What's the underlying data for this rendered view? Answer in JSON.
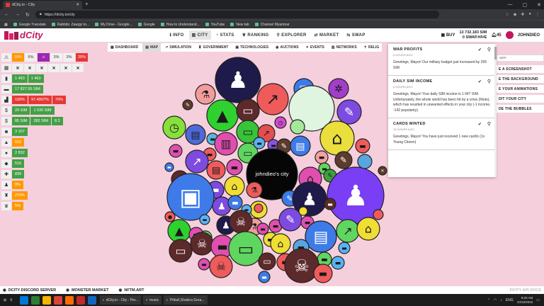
{
  "browser": {
    "tab_title": "dCity.io - City",
    "url": "https://dcity.io/city",
    "bookmarks": [
      "Google Translate",
      "Rabbits: Zawgyi to...",
      "My Drive - Google...",
      "Google",
      "How to Understand...",
      "YouTube",
      "New tab",
      "Channel Myanmar"
    ]
  },
  "header": {
    "logo_text": "dCity",
    "nav": [
      {
        "label": "INFO",
        "icon": "info-icon"
      },
      {
        "label": "CITY",
        "icon": "city-icon",
        "active": true
      },
      {
        "label": "STATS",
        "icon": "stats-icon"
      },
      {
        "label": "RANKING",
        "icon": "trophy-icon"
      },
      {
        "label": "EXPLORER",
        "icon": "search-icon"
      },
      {
        "label": "MARKET",
        "icon": "market-icon"
      },
      {
        "label": "SWAP",
        "icon": "swap-icon"
      }
    ],
    "buy_label": "BUY",
    "balance_sim": "13 732.183 SIM",
    "balance_swap": "0 SWAP.HIVE",
    "notif_count": "45",
    "username": "JOHNDIEO"
  },
  "subnav": [
    {
      "label": "DASHBOARD",
      "icon": "dashboard-icon"
    },
    {
      "label": "MAP",
      "icon": "map-icon",
      "active": true
    },
    {
      "label": "SIMULATION",
      "icon": "simulation-icon"
    },
    {
      "label": "GOVERNMENT",
      "icon": "government-icon"
    },
    {
      "label": "TECHNOLOGIES",
      "icon": "technologies-icon"
    },
    {
      "label": "AUCTIONS",
      "icon": "auctions-icon"
    },
    {
      "label": "EVENTS",
      "icon": "events-icon"
    },
    {
      "label": "NETWORKS",
      "icon": "networks-icon"
    },
    {
      "label": "RELIG",
      "icon": "religion-icon"
    }
  ],
  "sidebar": {
    "rows": [
      {
        "icon": "warning-icon",
        "glyph": "⚠",
        "chips": [
          {
            "text": "10%",
            "color": "#ff9800"
          },
          {
            "text": "6%",
            "color": "#f0f0f0",
            "dark": true
          },
          {
            "text": "☺",
            "color": "#9c27b0"
          },
          {
            "text": "3%",
            "color": "#f0f0f0",
            "dark": true
          },
          {
            "text": "3%",
            "color": "#f0f0f0",
            "dark": true
          },
          {
            "text": "20%",
            "color": "#e53935"
          }
        ]
      },
      {
        "icon": "calendar-icon",
        "glyph": "▦",
        "xs": 6
      },
      {
        "icon": "building-icon",
        "glyph": "▮",
        "chips": [
          {
            "text": "1 463",
            "color": "#43a047"
          },
          {
            "text": "1 463",
            "color": "#43a047"
          }
        ]
      },
      {
        "icon": "money-icon",
        "glyph": "▬",
        "chips": [
          {
            "text": "17 827.55 SIM",
            "color": "#43a047"
          }
        ]
      },
      {
        "icon": "pollution-icon",
        "glyph": "▟",
        "chips": [
          {
            "text": "100%",
            "color": "#e53935"
          },
          {
            "text": "97.4907%",
            "color": "#e53935"
          },
          {
            "text": "70%",
            "color": "#e53935"
          }
        ]
      },
      {
        "icon": "income-icon",
        "glyph": "$",
        "chips": [
          {
            "text": "29 SIM",
            "color": "#43a047"
          },
          {
            "text": "1 020 SIM",
            "color": "#43a047"
          }
        ]
      },
      {
        "icon": "tax-icon",
        "glyph": "$",
        "chips": [
          {
            "text": "85 SIM",
            "color": "#43a047"
          },
          {
            "text": "282 SIM",
            "color": "#43a047"
          },
          {
            "text": "8.3",
            "color": "#43a047"
          }
        ]
      },
      {
        "icon": "population-icon",
        "glyph": "☻",
        "chips": [
          {
            "text": "3 107",
            "color": "#43a047"
          }
        ]
      },
      {
        "icon": "workers-icon",
        "glyph": "▲",
        "chips": [
          {
            "text": "652",
            "color": "#ff9800"
          }
        ]
      },
      {
        "icon": "globe-icon",
        "glyph": "●",
        "chips": [
          {
            "text": "2 832",
            "color": "#43a047"
          }
        ]
      },
      {
        "icon": "education-icon",
        "glyph": "◆",
        "chips": [
          {
            "text": "516",
            "color": "#43a047"
          }
        ]
      },
      {
        "icon": "health-icon",
        "glyph": "✚",
        "chips": [
          {
            "text": "839",
            "color": "#43a047"
          }
        ]
      },
      {
        "icon": "crime-icon",
        "glyph": "♟",
        "chips": [
          {
            "text": "8%",
            "color": "#ff9800"
          }
        ]
      },
      {
        "icon": "unemployment-icon",
        "glyph": "♜",
        "chips": [
          {
            "text": "270%",
            "color": "#ff9800"
          }
        ]
      },
      {
        "icon": "happiness-icon",
        "glyph": "♛",
        "chips": [
          {
            "text": "5%",
            "color": "#ff9800"
          }
        ]
      }
    ]
  },
  "city_label": "johndieo's city",
  "notifications": [
    {
      "title": "WAR PROFITS",
      "time": "6 HOURS AGO",
      "body": "Greetings, Mayor! Our military budget just increased by 255 SIM"
    },
    {
      "title": "DAILY SIM INCOME",
      "time": "6 HOURS AGO",
      "body": "Greetings, Mayor! Your daily SIM income is 1 047 SIM. Unfortunately, the whole world has been hit by a crisis (Riots), which has resulted in unwanted effects in your city (-1 income, -142 popularity)."
    },
    {
      "title": "CARDS MINTED",
      "time": "15 HOURS AGO",
      "body": "Greetings, Mayor! You have just received 1 new card/s (1x Young Citizen)"
    }
  ],
  "right_panel": {
    "search_placeholder": "ayer",
    "buttons": [
      "E A SCREENSHOT",
      "E THE BACKGROUND",
      "E YOUR ANIMATIONS",
      "DIT YOUR CITY",
      "DE THE BUBBLES"
    ]
  },
  "footer": {
    "links": [
      {
        "label": "DCITY DISCORD SERVER",
        "icon": "discord-icon"
      },
      {
        "label": "MONSTER MARKET",
        "icon": "monster-icon"
      },
      {
        "label": "NFTM.ART",
        "icon": "nftm-icon"
      }
    ],
    "api_label": "DCITY API DOCS"
  },
  "taskbar": {
    "windows": [
      "dCity.io - City - Per...",
      "music",
      "Pitbull,Shakira Grea..."
    ],
    "lang": "ENG",
    "time": "9:20 AM",
    "date": "10/16/2022"
  }
}
